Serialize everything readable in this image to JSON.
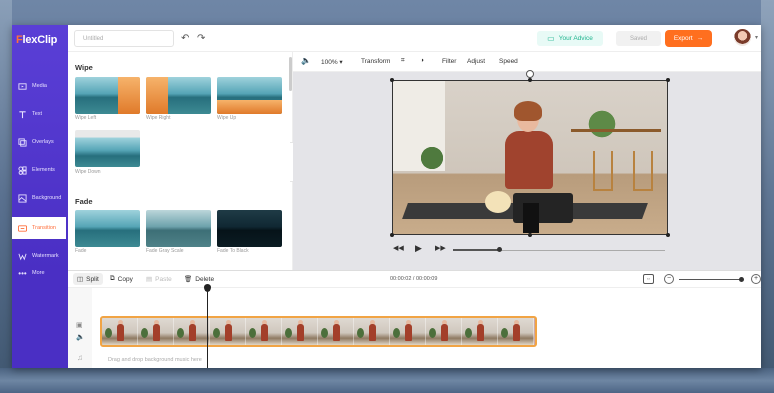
{
  "app": {
    "logo_main": "lexClip",
    "logo_f": "F"
  },
  "header": {
    "title_placeholder": "Untitled",
    "advice_label": "Your Advice",
    "saved_label": "Saved",
    "export_label": "Export"
  },
  "sidebar": {
    "items": [
      {
        "label": "Media",
        "icon": "media-icon"
      },
      {
        "label": "Text",
        "icon": "text-icon"
      },
      {
        "label": "Overlays",
        "icon": "overlays-icon"
      },
      {
        "label": "Elements",
        "icon": "elements-icon"
      },
      {
        "label": "Background",
        "icon": "background-icon"
      },
      {
        "label": "Transition",
        "icon": "transition-icon",
        "active": true
      },
      {
        "label": "Watermark",
        "icon": "watermark-icon"
      },
      {
        "label": "More",
        "icon": "more-icon"
      }
    ]
  },
  "panel": {
    "sections": [
      {
        "title": "Wipe",
        "items": [
          "Wipe Left",
          "Wipe Right",
          "Wipe Up",
          "Wipe Down"
        ]
      },
      {
        "title": "Fade",
        "items": [
          "Fade",
          "Fade Gray Scale",
          "Fade To Black"
        ]
      }
    ]
  },
  "toolbar": {
    "zoom": "100%",
    "transform": "Transform",
    "filter": "Filter",
    "adjust": "Adjust",
    "speed": "Speed"
  },
  "player": {
    "progress": 0.22
  },
  "timeline": {
    "split": "Split",
    "copy": "Copy",
    "paste": "Paste",
    "delete": "Delete",
    "time": "00:00:02 / 00:00:09",
    "music_hint": "Drag and drop background music here"
  },
  "colors": {
    "accent": "#ff6f1f",
    "sidebar": "#5a3fd6",
    "advice": "#1fb58f"
  }
}
